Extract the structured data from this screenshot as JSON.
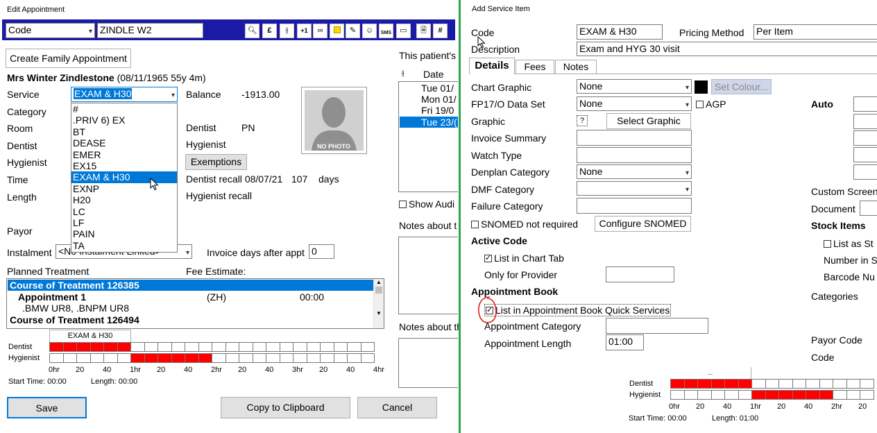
{
  "left": {
    "window_title": "Edit Appointment",
    "toolbar": {
      "code_select": "Code",
      "search_value": "ZINDLE W2",
      "icons": [
        "search-icon",
        "pound-icon",
        "split-icon",
        "plus-one-icon",
        "glasses-icon",
        "note-icon",
        "pencil-icon",
        "contacts-icon",
        "sms-icon",
        "card-icon",
        "document-icon",
        "grid-icon"
      ],
      "plus_one": "+1",
      "sms": "SMS"
    },
    "create_family_button": "Create Family Appointment",
    "patient_name": "Mrs Winter Zindlestone",
    "patient_dob": "(08/11/1965 55y 4m)",
    "labels": {
      "service": "Service",
      "category": "Category",
      "room": "Room",
      "dentist": "Dentist",
      "hygienist": "Hygienist",
      "time": "Time",
      "length": "Length",
      "payor": "Payor",
      "instalment": "Instalment",
      "balance": "Balance",
      "dentist_right": "Dentist",
      "hygienist_right": "Hygienist",
      "dentist_recall": "Dentist recall",
      "hygienist_recall": "Hygienist recall",
      "invoice_days": "Invoice days after appt",
      "planned_treatment": "Planned Treatment",
      "fee_estimate": "Fee Estimate:"
    },
    "service_value": "EXAM & H30",
    "service_options": [
      "#",
      ".PRIV 6) EX",
      "BT",
      "DEASE",
      "EMER",
      "EX15",
      "EXAM & H30",
      "EXNP",
      "H20",
      "LC",
      "LF",
      "PAIN",
      "TA"
    ],
    "service_selected_index": 6,
    "balance_value": "-1913.00",
    "dentist_value": "PN",
    "exemptions_button": "Exemptions",
    "dentist_recall_date": "08/07/21",
    "dentist_recall_days": "107",
    "dentist_recall_unit": "days",
    "no_photo": "NO PHOTO",
    "instalment_value": "<No Instalment Linked>",
    "invoice_days_value": "0",
    "treatment": {
      "course1": "Course of Treatment 126385",
      "appointment1": "Appointment 1",
      "appointment1_code": "(ZH)",
      "appointment1_time": "00:00",
      "items": ".BMW  UR8, .BNPM  UR8",
      "course2": "Course of Treatment 126494"
    },
    "timeline": {
      "tab_label": "EXAM & H30",
      "row1": "Dentist",
      "row2": "Hygienist",
      "ticks": [
        "0hr",
        "20",
        "40",
        "1hr",
        "20",
        "40",
        "2hr",
        "20",
        "40",
        "3hr",
        "20",
        "40",
        "4hr"
      ],
      "start_time": "Start Time: 00:00",
      "length": "Length: 00:00"
    },
    "buttons": {
      "save": "Save",
      "copy": "Copy to Clipboard",
      "cancel": "Cancel"
    },
    "right_panel": {
      "patient_heading": "This patient's",
      "date_col": "Date",
      "dates": [
        "Tue 01/",
        "Mon 01/",
        "Fri 19/0",
        "Tue 23/("
      ],
      "show_audit": "Show Audi",
      "notes_about_1": "Notes about t",
      "notes_about_2": "Notes about th"
    }
  },
  "right": {
    "window_title": "Add Service Item",
    "code_label": "Code",
    "code_value": "EXAM & H30",
    "pricing_method_label": "Pricing Method",
    "pricing_method_value": "Per Item",
    "description_label": "Description",
    "description_value": "Exam and HYG 30 visit",
    "tabs": [
      "Details",
      "Fees",
      "Notes"
    ],
    "fields": {
      "chart_graphic": "Chart Graphic",
      "chart_graphic_value": "None",
      "set_colour": "Set Colour...",
      "fp17": "FP17/O Data Set",
      "fp17_value": "None",
      "agp": "AGP",
      "auto": "Auto",
      "graphic": "Graphic",
      "graphic_placeholder": "?",
      "select_graphic": "Select Graphic",
      "invoice_summary": "Invoice Summary",
      "watch_type": "Watch Type",
      "denplan_category": "Denplan Category",
      "denplan_value": "None",
      "dmf_category": "DMF Category",
      "failure_category": "Failure Category",
      "custom_screen": "Custom Screen",
      "document": "Document",
      "snomed_not_required": "SNOMED not required",
      "configure_snomed": "Configure SNOMED",
      "stock_items": "Stock Items",
      "active_code": "Active Code",
      "list_as": "List as St",
      "list_in_chart_tab": "List in Chart Tab",
      "number_in": "Number in S",
      "only_for_provider": "Only for Provider",
      "barcode": "Barcode Nu",
      "appointment_book": "Appointment Book",
      "categories": "Categories",
      "list_in_quick_services": "List in Appointment Book Quick Services",
      "appointment_category": "Appointment Category",
      "appointment_length": "Appointment Length",
      "appointment_length_value": "01:00",
      "payor_code": "Payor Code",
      "code": "Code"
    },
    "timeline": {
      "dots": "...",
      "row1": "Dentist",
      "row2": "Hygienist",
      "ticks": [
        "0hr",
        "20",
        "40",
        "1hr",
        "20",
        "40",
        "2hr",
        "20"
      ],
      "start_time": "Start Time: 00:00",
      "length": "Length: 01:00"
    }
  },
  "colors": {
    "selection": "#0078d7",
    "block_red": "#ff0000",
    "divider_green": "#2ea44f",
    "annotation_red": "#e0201a"
  }
}
